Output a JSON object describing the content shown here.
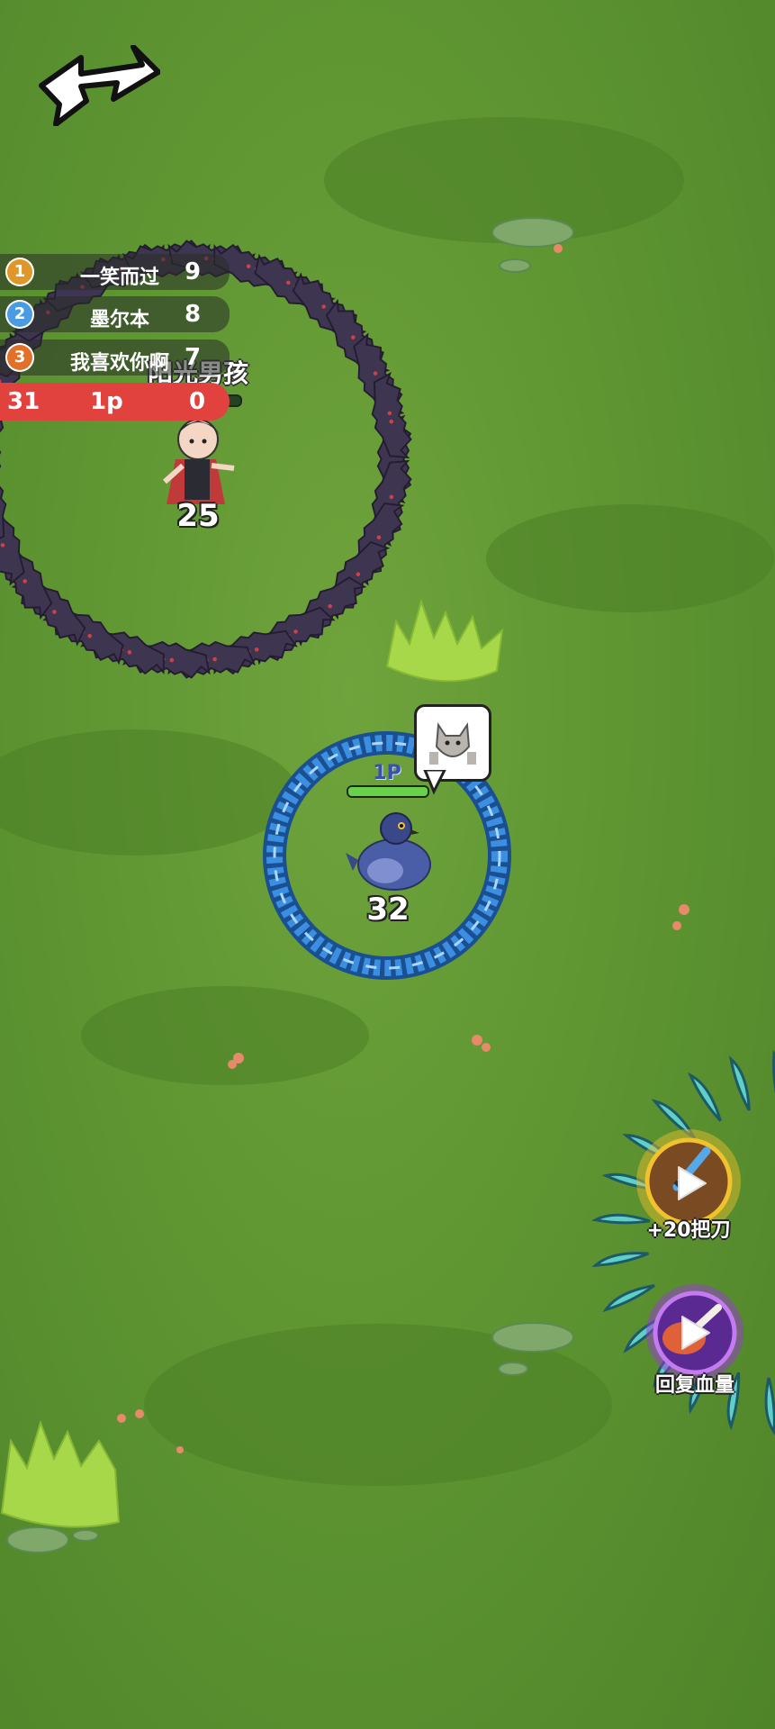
{
  "leaderboard": [
    {
      "rank": "1",
      "name": "一笑而过",
      "score": "9",
      "medal_color": "#e0972a"
    },
    {
      "rank": "2",
      "name": "墨尔本",
      "score": "8",
      "medal_color": "#4a9be0"
    },
    {
      "rank": "3",
      "name": "我喜欢你啊",
      "score": "7",
      "medal_color": "#e0702a"
    }
  ],
  "scorebar": {
    "left": "31",
    "middle": "1p",
    "right": "0",
    "color": "#e2423e"
  },
  "enemy": {
    "name": "阳光男孩",
    "count": "25",
    "health": 0.6
  },
  "player": {
    "tag": "1P",
    "count": "32",
    "health": 1.0,
    "ring_color": "#3c8fe0"
  },
  "buttons": {
    "swords": {
      "label": "+20把刀",
      "icon": "play-icon"
    },
    "heal": {
      "label": "回复血量",
      "icon": "play-icon"
    }
  },
  "colors": {
    "grass": "#5f9632",
    "bat": "#3e3550",
    "bat_eye": "#d0404a",
    "blade": "#5fd0c8"
  }
}
